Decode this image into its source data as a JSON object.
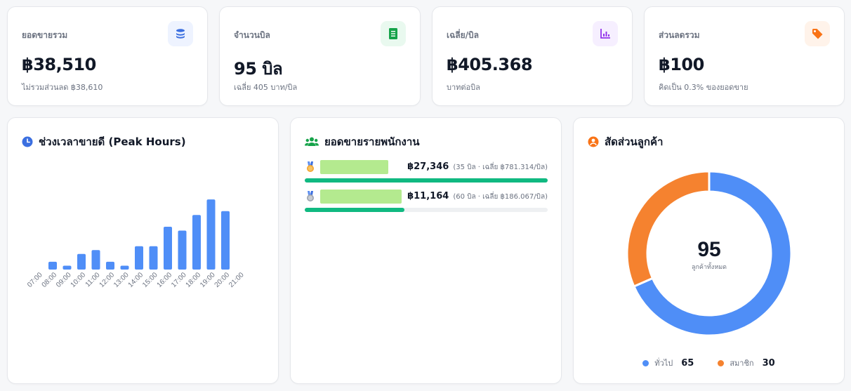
{
  "stats": [
    {
      "label": "ยอดขายรวม",
      "value": "฿38,510",
      "sub": "ไม่รวมส่วนลด ฿38,610",
      "icon": "coins-icon",
      "icon_bg": "#eef3ff",
      "icon_color": "#3b6fe0"
    },
    {
      "label": "จำนวนบิล",
      "value": "95 บิล",
      "sub": "เฉลี่ย 405 บาท/บิล",
      "icon": "receipt-icon",
      "icon_bg": "#e9f9ef",
      "icon_color": "#16a34a"
    },
    {
      "label": "เฉลี่ย/บิล",
      "value": "฿405.368",
      "sub": "บาทต่อบิล",
      "icon": "chart-icon",
      "icon_bg": "#f6efff",
      "icon_color": "#9333ea"
    },
    {
      "label": "ส่วนลดรวม",
      "value": "฿100",
      "sub": "คิดเป็น 0.3% ของยอดขาย",
      "icon": "tag-icon",
      "icon_bg": "#fff3ea",
      "icon_color": "#f97316"
    }
  ],
  "peak": {
    "title": "ช่วงเวลาขายดี (Peak Hours)",
    "icon": "clock-icon",
    "color": "#4f8ef7",
    "chart_data": {
      "type": "bar",
      "categories": [
        "07:00",
        "08:00",
        "09:00",
        "10:00",
        "11:00",
        "12:00",
        "13:00",
        "14:00",
        "15:00",
        "16:00",
        "17:00",
        "18:00",
        "19:00",
        "20:00",
        "21:00"
      ],
      "values": [
        2,
        1,
        4,
        5,
        2,
        1,
        6,
        6,
        11,
        10,
        14,
        18,
        15
      ],
      "title": "",
      "xlabel": "",
      "ylabel": "",
      "ylim": [
        0,
        20
      ],
      "grid": false
    }
  },
  "employees": {
    "title": "ยอดขายรายพนักงาน",
    "icon": "users-icon",
    "rows": [
      {
        "rank": 1,
        "medal": "gold-medal-icon",
        "amount": "฿27,346",
        "detail": "(35 บิล · เฉลี่ย ฿781.314/บิล)",
        "share": 1.0
      },
      {
        "rank": 2,
        "medal": "silver-medal-icon",
        "amount": "฿11,164",
        "detail": "(60 บิล · เฉลี่ย ฿186.067/บิล)",
        "share": 0.41
      }
    ]
  },
  "customers": {
    "title": "สัดส่วนลูกค้า",
    "icon": "user-circle-icon",
    "total": "95",
    "total_label": "ลูกค้าทั้งหมด",
    "chart_data": {
      "type": "pie",
      "title": "",
      "categories": [
        "ทั่วไป",
        "สมาชิก"
      ],
      "values": [
        65,
        30
      ],
      "colors": [
        "#4f8ef7",
        "#f5822f"
      ],
      "legend": "bottom"
    },
    "legend": [
      {
        "label": "ทั่วไป",
        "value": "65",
        "color": "#4f8ef7"
      },
      {
        "label": "สมาชิก",
        "value": "30",
        "color": "#f5822f"
      }
    ]
  }
}
